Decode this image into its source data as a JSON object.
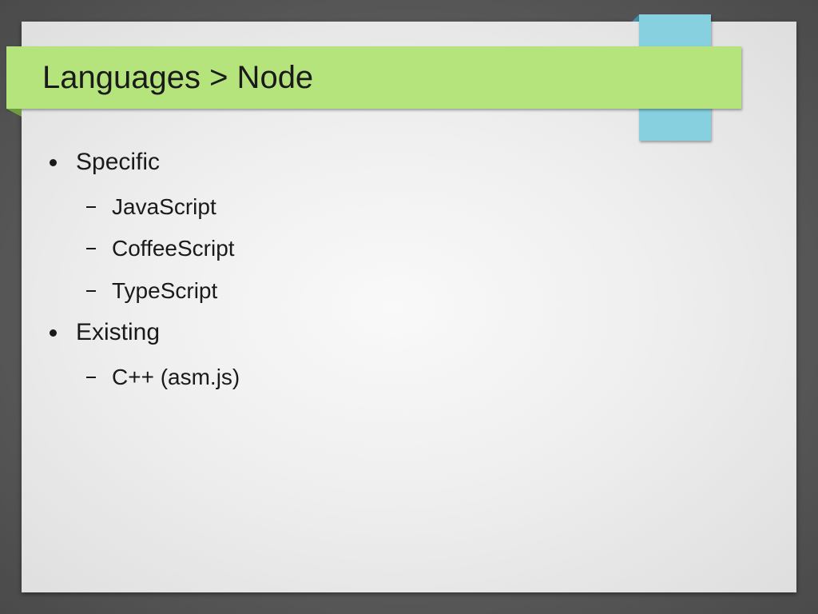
{
  "slide": {
    "title": "Languages > Node",
    "bullets": [
      {
        "text": "Specific",
        "subitems": [
          "JavaScript",
          "CoffeeScript",
          "TypeScript"
        ]
      },
      {
        "text": "Existing",
        "subitems": [
          "C++ (asm.js)"
        ]
      }
    ]
  },
  "colors": {
    "background": "#5a5a5a",
    "paper": "#f4f4f4",
    "title_ribbon": "#b6e47c",
    "tab": "#86d0df",
    "text": "#1a1a1a"
  }
}
